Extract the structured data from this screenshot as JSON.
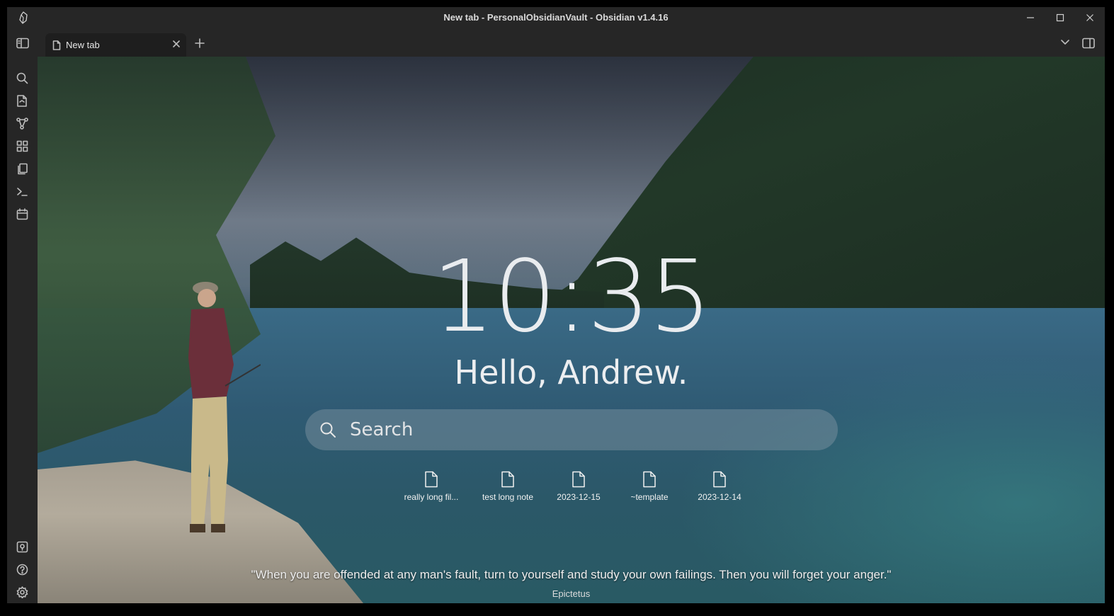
{
  "window": {
    "title": "New tab - PersonalObsidianVault - Obsidian v1.4.16"
  },
  "tabs": [
    {
      "label": "New tab",
      "active": true
    }
  ],
  "ribbon_top": [
    "search-icon",
    "quick-switcher-icon",
    "graph-view-icon",
    "canvas-icon",
    "templates-icon",
    "command-palette-icon",
    "daily-notes-calendar-icon"
  ],
  "ribbon_bottom": [
    "vault-switcher-icon",
    "help-icon",
    "settings-icon"
  ],
  "home": {
    "time": "10:35",
    "greeting": "Hello, Andrew.",
    "search_placeholder": "Search",
    "recent_files": [
      {
        "label": "really long fil..."
      },
      {
        "label": "test long note"
      },
      {
        "label": "2023-12-15"
      },
      {
        "label": "~template"
      },
      {
        "label": "2023-12-14"
      }
    ],
    "quote": "\"When you are offended at any man's fault, turn to yourself and study your own failings. Then you will forget your anger.\"",
    "quote_author": "Epictetus"
  },
  "colors": {
    "chrome": "#262626",
    "active_tab": "#1e1e1e",
    "text": "#dadada"
  }
}
